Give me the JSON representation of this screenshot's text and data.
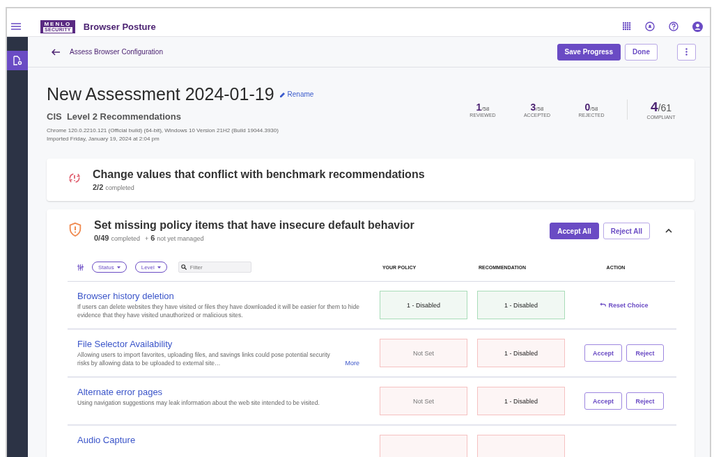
{
  "topbar": {
    "logo_top": "MENLO",
    "logo_bottom": "SECURITY",
    "title": "Browser Posture"
  },
  "subheader": {
    "breadcrumb": "Assess Browser Configuration",
    "buttons": [
      {
        "label": "Save Progress",
        "kind": "primary"
      },
      {
        "label": "Done",
        "kind": "outline"
      }
    ]
  },
  "assessment": {
    "title": "New Assessment 2024-01-19",
    "rename": "Rename",
    "benchmark": "CIS  Level 2 Recommendations",
    "build": "Chrome 120.0.2210.121 (Official build) (64-bit), Windows 10 Version 21H2 (Build 19044.3930)",
    "imported": "Imported Friday, January 19, 2024 at 2:04 pm"
  },
  "stats": [
    {
      "value": "1",
      "total": "/58",
      "label": "REVIEWED",
      "kind": "small"
    },
    {
      "value": "3",
      "total": "/58",
      "label": "ACCEPTED",
      "kind": "small"
    },
    {
      "value": "0",
      "total": "/58",
      "label": "REJECTED",
      "kind": "small"
    },
    {
      "value": "4",
      "total": "/61",
      "label": "COMPLIANT",
      "kind": "large"
    }
  ],
  "sections": [
    {
      "kind": "conflict",
      "title": "Change values that conflict with benchmark recommendations",
      "count": "2/2",
      "count_label": "completed",
      "expanded": false
    },
    {
      "kind": "missing",
      "title": "Set missing policy items that have insecure default behavior",
      "count": "0/49",
      "count_label": "completed",
      "extra_prefix": "+",
      "extra_count": "6",
      "extra_label": "not yet managed",
      "expanded": true,
      "actions": [
        "Accept All",
        "Reject All"
      ],
      "filters": [
        "Status",
        "Level"
      ],
      "search": {
        "placeholder": "Filter"
      },
      "columns": [
        "YOUR POLICY",
        "RECOMMENDATION",
        "ACTION"
      ],
      "rows": [
        {
          "name": "Browser history deletion",
          "description": "If users can delete websites they have visited or files they have downloaded it will be easier for them to hide evidence that they have visited unauthorized or malicious sites.",
          "compliant": true,
          "your_policy": "1 - Disabled",
          "recommendation": "1 - Disabled",
          "actions": [
            "Reset Choice"
          ]
        },
        {
          "name": "File Selector Availability",
          "description": "Allowing users to import favorites, uploading files, and savings links could pose potential security risks by allowing data to be uploaded to external site…",
          "more": "More",
          "compliant": false,
          "your_policy": "Not Set",
          "recommendation": "1 - Disabled",
          "actions": [
            "Accept",
            "Reject"
          ]
        },
        {
          "name": "Alternate error pages",
          "description": "Using navigation suggestions may leak information about the web site intended to be visited.",
          "compliant": false,
          "your_policy": "Not Set",
          "recommendation": "1 - Disabled",
          "actions": [
            "Accept",
            "Reject"
          ]
        },
        {
          "name": "Audio Capture",
          "compliant": false
        }
      ]
    }
  ]
}
